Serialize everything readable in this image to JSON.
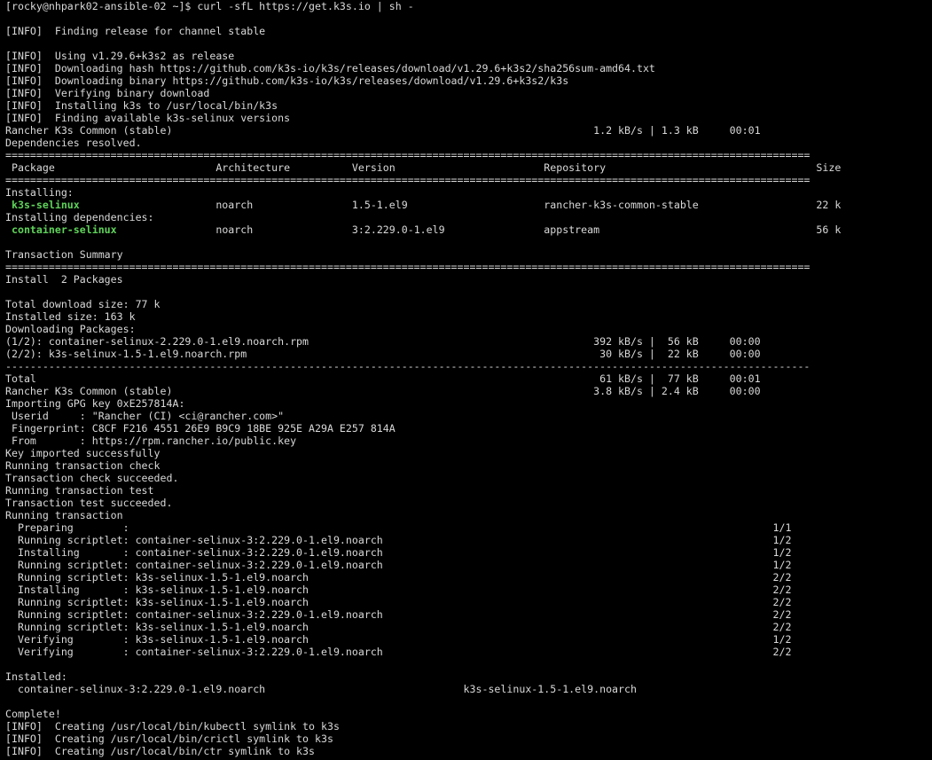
{
  "colors": {
    "background": "#000000",
    "foreground": "#d9d9d9",
    "highlight_green": "#5fd35a"
  },
  "terminal": {
    "lines": [
      {
        "segments": [
          {
            "text": "[rocky@nhpark02-ansible-02 ~]$ curl -sfL https://get.k3s.io | sh -"
          }
        ]
      },
      {
        "segments": [
          {
            "text": ""
          }
        ]
      },
      {
        "segments": [
          {
            "text": "[INFO]  Finding release for channel stable"
          }
        ]
      },
      {
        "segments": [
          {
            "text": ""
          }
        ]
      },
      {
        "segments": [
          {
            "text": "[INFO]  Using v1.29.6+k3s2 as release"
          }
        ]
      },
      {
        "segments": [
          {
            "text": "[INFO]  Downloading hash https://github.com/k3s-io/k3s/releases/download/v1.29.6+k3s2/sha256sum-amd64.txt"
          }
        ]
      },
      {
        "segments": [
          {
            "text": "[INFO]  Downloading binary https://github.com/k3s-io/k3s/releases/download/v1.29.6+k3s2/k3s"
          }
        ]
      },
      {
        "segments": [
          {
            "text": "[INFO]  Verifying binary download"
          }
        ]
      },
      {
        "segments": [
          {
            "text": "[INFO]  Installing k3s to /usr/local/bin/k3s"
          }
        ]
      },
      {
        "segments": [
          {
            "text": "[INFO]  Finding available k3s-selinux versions"
          }
        ]
      },
      {
        "segments": [
          {
            "text": "Rancher K3s Common (stable)                                                                    1.2 kB/s | 1.3 kB     00:01"
          }
        ]
      },
      {
        "segments": [
          {
            "text": "Dependencies resolved."
          }
        ]
      },
      {
        "segments": [
          {
            "text": "=================================================================================================================================="
          }
        ]
      },
      {
        "segments": [
          {
            "text": " Package                          Architecture          Version                        Repository                                  Size"
          }
        ]
      },
      {
        "segments": [
          {
            "text": "=================================================================================================================================="
          }
        ]
      },
      {
        "segments": [
          {
            "text": "Installing:"
          }
        ]
      },
      {
        "segments": [
          {
            "text": " "
          },
          {
            "text": "k3s-selinux",
            "green": true
          },
          {
            "text": "                      noarch                1.5-1.el9                      rancher-k3s-common-stable                   22 k"
          }
        ]
      },
      {
        "segments": [
          {
            "text": "Installing dependencies:"
          }
        ]
      },
      {
        "segments": [
          {
            "text": " "
          },
          {
            "text": "container-selinux",
            "green": true
          },
          {
            "text": "                noarch                3:2.229.0-1.el9                appstream                                   56 k"
          }
        ]
      },
      {
        "segments": [
          {
            "text": ""
          }
        ]
      },
      {
        "segments": [
          {
            "text": "Transaction Summary"
          }
        ]
      },
      {
        "segments": [
          {
            "text": "=================================================================================================================================="
          }
        ]
      },
      {
        "segments": [
          {
            "text": "Install  2 Packages"
          }
        ]
      },
      {
        "segments": [
          {
            "text": ""
          }
        ]
      },
      {
        "segments": [
          {
            "text": "Total download size: 77 k"
          }
        ]
      },
      {
        "segments": [
          {
            "text": "Installed size: 163 k"
          }
        ]
      },
      {
        "segments": [
          {
            "text": "Downloading Packages:"
          }
        ]
      },
      {
        "segments": [
          {
            "text": "(1/2): container-selinux-2.229.0-1.el9.noarch.rpm                                              392 kB/s |  56 kB     00:00"
          }
        ]
      },
      {
        "segments": [
          {
            "text": "(2/2): k3s-selinux-1.5-1.el9.noarch.rpm                                                         30 kB/s |  22 kB     00:00"
          }
        ]
      },
      {
        "segments": [
          {
            "text": "----------------------------------------------------------------------------------------------------------------------------------"
          }
        ]
      },
      {
        "segments": [
          {
            "text": "Total                                                                                           61 kB/s |  77 kB     00:01"
          }
        ]
      },
      {
        "segments": [
          {
            "text": "Rancher K3s Common (stable)                                                                    3.8 kB/s | 2.4 kB     00:00"
          }
        ]
      },
      {
        "segments": [
          {
            "text": "Importing GPG key 0xE257814A:"
          }
        ]
      },
      {
        "segments": [
          {
            "text": " Userid     : \"Rancher (CI) <ci@rancher.com>\""
          }
        ]
      },
      {
        "segments": [
          {
            "text": " Fingerprint: C8CF F216 4551 26E9 B9C9 18BE 925E A29A E257 814A"
          }
        ]
      },
      {
        "segments": [
          {
            "text": " From       : https://rpm.rancher.io/public.key"
          }
        ]
      },
      {
        "segments": [
          {
            "text": "Key imported successfully"
          }
        ]
      },
      {
        "segments": [
          {
            "text": "Running transaction check"
          }
        ]
      },
      {
        "segments": [
          {
            "text": "Transaction check succeeded."
          }
        ]
      },
      {
        "segments": [
          {
            "text": "Running transaction test"
          }
        ]
      },
      {
        "segments": [
          {
            "text": "Transaction test succeeded."
          }
        ]
      },
      {
        "segments": [
          {
            "text": "Running transaction"
          }
        ]
      },
      {
        "segments": [
          {
            "text": "  Preparing        :                                                                                                        1/1"
          }
        ]
      },
      {
        "segments": [
          {
            "text": "  Running scriptlet: container-selinux-3:2.229.0-1.el9.noarch                                                               1/2"
          }
        ]
      },
      {
        "segments": [
          {
            "text": "  Installing       : container-selinux-3:2.229.0-1.el9.noarch                                                               1/2"
          }
        ]
      },
      {
        "segments": [
          {
            "text": "  Running scriptlet: container-selinux-3:2.229.0-1.el9.noarch                                                               1/2"
          }
        ]
      },
      {
        "segments": [
          {
            "text": "  Running scriptlet: k3s-selinux-1.5-1.el9.noarch                                                                           2/2"
          }
        ]
      },
      {
        "segments": [
          {
            "text": "  Installing       : k3s-selinux-1.5-1.el9.noarch                                                                           2/2"
          }
        ]
      },
      {
        "segments": [
          {
            "text": "  Running scriptlet: k3s-selinux-1.5-1.el9.noarch                                                                           2/2"
          }
        ]
      },
      {
        "segments": [
          {
            "text": "  Running scriptlet: container-selinux-3:2.229.0-1.el9.noarch                                                               2/2"
          }
        ]
      },
      {
        "segments": [
          {
            "text": "  Running scriptlet: k3s-selinux-1.5-1.el9.noarch                                                                           2/2"
          }
        ]
      },
      {
        "segments": [
          {
            "text": "  Verifying        : k3s-selinux-1.5-1.el9.noarch                                                                           1/2"
          }
        ]
      },
      {
        "segments": [
          {
            "text": "  Verifying        : container-selinux-3:2.229.0-1.el9.noarch                                                               2/2"
          }
        ]
      },
      {
        "segments": [
          {
            "text": ""
          }
        ]
      },
      {
        "segments": [
          {
            "text": "Installed:"
          }
        ]
      },
      {
        "segments": [
          {
            "text": "  container-selinux-3:2.229.0-1.el9.noarch                                k3s-selinux-1.5-1.el9.noarch"
          }
        ]
      },
      {
        "segments": [
          {
            "text": ""
          }
        ]
      },
      {
        "segments": [
          {
            "text": "Complete!"
          }
        ]
      },
      {
        "segments": [
          {
            "text": "[INFO]  Creating /usr/local/bin/kubectl symlink to k3s"
          }
        ]
      },
      {
        "segments": [
          {
            "text": "[INFO]  Creating /usr/local/bin/crictl symlink to k3s"
          }
        ]
      },
      {
        "segments": [
          {
            "text": "[INFO]  Creating /usr/local/bin/ctr symlink to k3s"
          }
        ]
      }
    ]
  }
}
